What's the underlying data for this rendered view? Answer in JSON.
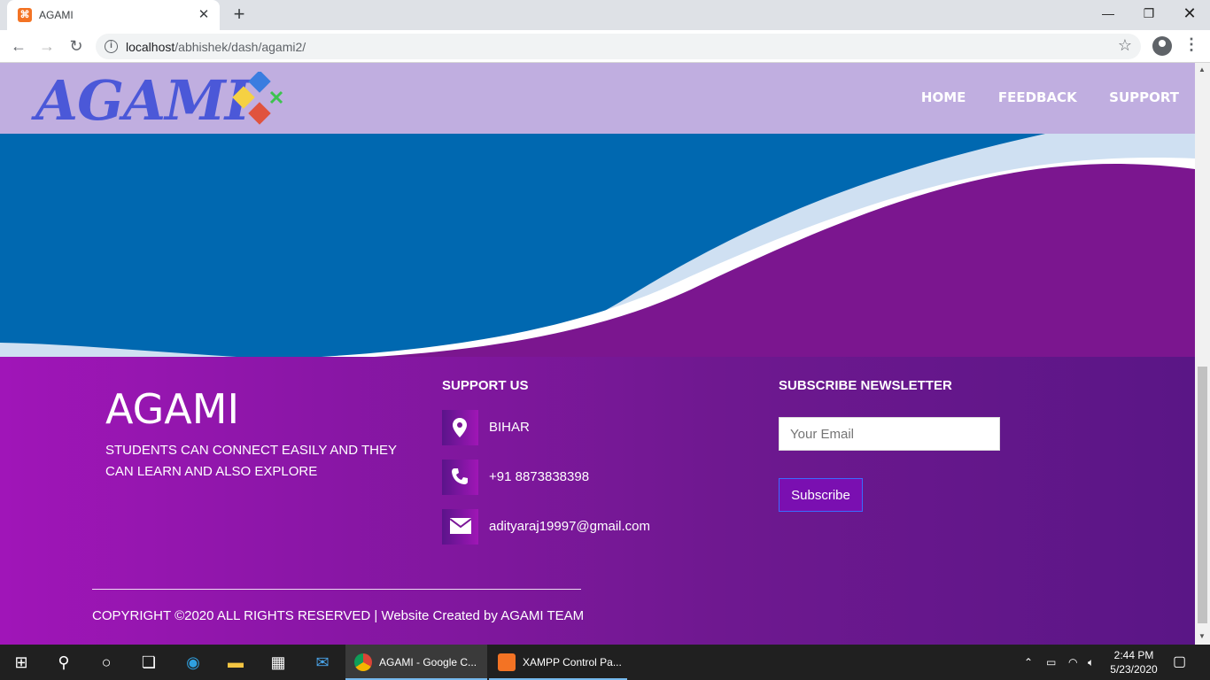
{
  "browser": {
    "tab_title": "AGAMI",
    "url_host": "localhost",
    "url_path": "/abhishek/dash/agami2/"
  },
  "header": {
    "logo_text": "AGAMI",
    "nav": [
      "HOME",
      "FEEDBACK",
      "SUPPORT"
    ]
  },
  "footer": {
    "brand": "AGAMI",
    "tagline": "STUDENTS CAN CONNECT EASILY AND THEY CAN LEARN AND ALSO EXPLORE",
    "support_heading": "SUPPORT US",
    "location": "BIHAR",
    "phone": "+91 8873838398",
    "email": "adityaraj19997@gmail.com",
    "subscribe_heading": "SUBSCRIBE NEWSLETTER",
    "email_placeholder": "Your Email",
    "subscribe_label": "Subscribe",
    "copyright": "COPYRIGHT ©2020 ALL RIGHTS RESERVED | Website Created by AGAMI TEAM"
  },
  "taskbar": {
    "apps": [
      "AGAMI - Google C...",
      "XAMPP Control Pa..."
    ],
    "time": "2:44 PM",
    "date": "5/23/2020"
  },
  "colors": {
    "header_bg": "#c0aee0",
    "wave_blue": "#0068b0",
    "footer_purple": "#a015b8"
  }
}
